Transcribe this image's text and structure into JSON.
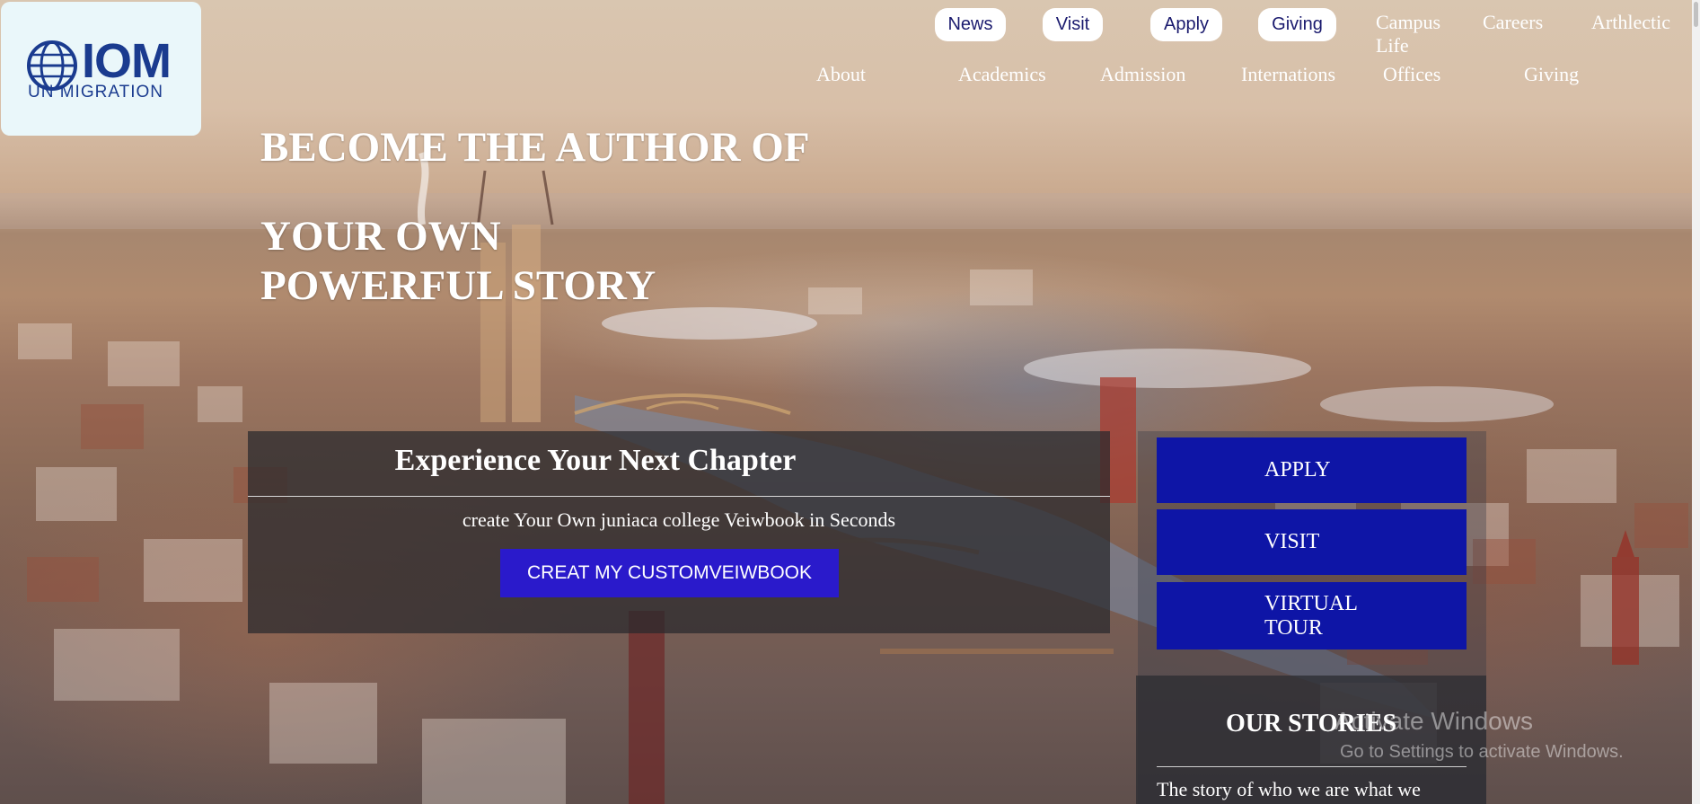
{
  "logo": {
    "wordmark": "IOM",
    "tagline": "UN MIGRATION"
  },
  "utility_nav": {
    "pills": [
      "News",
      "Visit",
      "Apply",
      "Giving"
    ],
    "links": [
      "Campus Life",
      "Careers",
      "Arthlectic"
    ]
  },
  "main_nav": {
    "items": [
      "About",
      "Academics",
      "Admission",
      "Internations",
      "Offices",
      "Giving"
    ]
  },
  "hero": {
    "line1": "BECOME THE AUTHOR OF",
    "line2": "YOUR OWN",
    "line3": "POWERFUL STORY"
  },
  "chapter_panel": {
    "title": "Experience Your Next Chapter",
    "subtitle": "create Your Own juniaca college Veiwbook in Seconds",
    "cta_label": "CREAT MY CUSTOMVEIWBOOK"
  },
  "side_buttons": {
    "apply": "APPLY",
    "visit": "VISIT",
    "virtual_tour": "VIRTUAL TOUR"
  },
  "stories": {
    "title": "OUR STORIES",
    "text": "The story of who we are what we"
  },
  "os_watermark": {
    "line1": "Activate Windows",
    "line2": "Go to Settings to activate Windows."
  },
  "colors": {
    "brand_blue": "#1a3b8f",
    "cta_purple": "#2a1acb",
    "side_button_blue": "#0e15a6"
  }
}
